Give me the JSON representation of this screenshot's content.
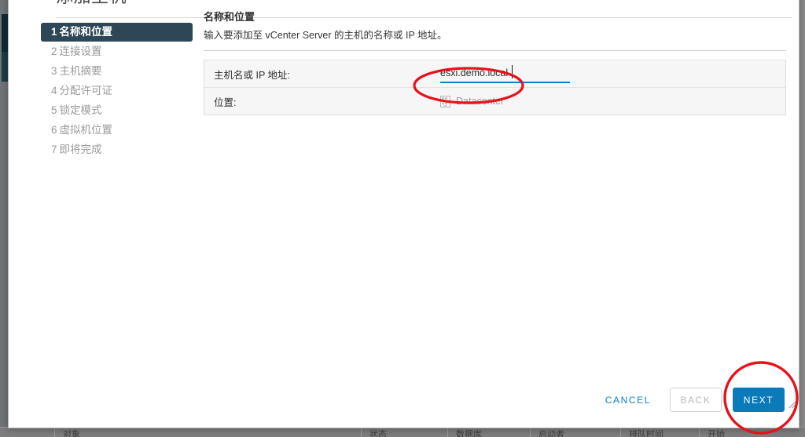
{
  "dialog": {
    "title": "添加主机"
  },
  "steps": [
    {
      "num": "1",
      "label": "名称和位置",
      "active": true
    },
    {
      "num": "2",
      "label": "连接设置",
      "active": false
    },
    {
      "num": "3",
      "label": "主机摘要",
      "active": false
    },
    {
      "num": "4",
      "label": "分配许可证",
      "active": false
    },
    {
      "num": "5",
      "label": "锁定模式",
      "active": false
    },
    {
      "num": "6",
      "label": "虚拟机位置",
      "active": false
    },
    {
      "num": "7",
      "label": "即将完成",
      "active": false
    }
  ],
  "content": {
    "heading": "名称和位置",
    "description": "输入要添加至 vCenter Server 的主机的名称或 IP 地址。",
    "rows": {
      "hostname": {
        "label": "主机名或 IP 地址:",
        "value": "esxi.demo.local",
        "placeholder": ""
      },
      "location": {
        "label": "位置:",
        "value": "Datacenter",
        "icon": "datacenter-icon"
      }
    }
  },
  "footer": {
    "cancel_label": "CANCEL",
    "back_label": "BACK",
    "next_label": "NEXT"
  },
  "background": {
    "table_columns": [
      "对象",
      "状态",
      "数据库",
      "启动者",
      "排队时间",
      "开始"
    ]
  },
  "colors": {
    "accent_blue": "#0a7bb8",
    "link_blue": "#0f81c4",
    "step_active_bg": "#2e4756",
    "annotation_red": "#e8121b",
    "row_bg": "#f6f6f6",
    "muted_text": "#9a9a9a"
  }
}
